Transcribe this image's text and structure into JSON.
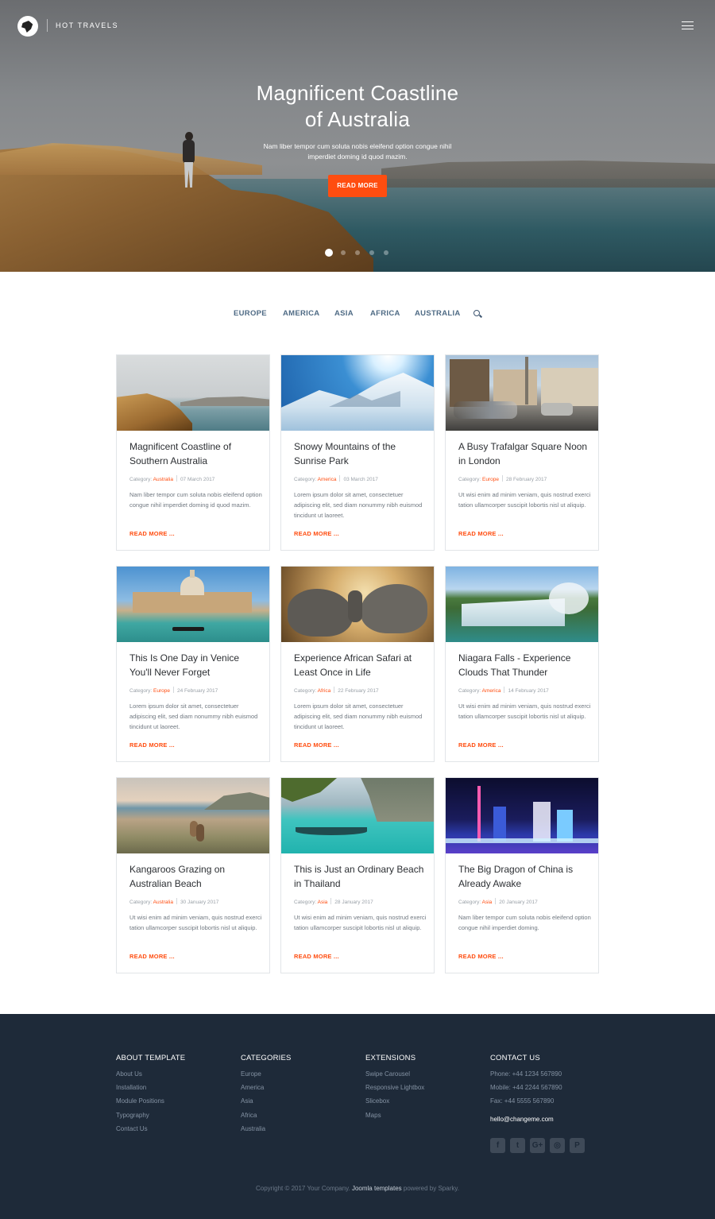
{
  "brand": {
    "name": "HOT TRAVELS",
    "logo": "globe-icon"
  },
  "hero": {
    "title_line1": "Magnificent Coastline",
    "title_line2": "of Australia",
    "subtitle": "Nam liber tempor cum soluta nobis eleifend option congue nihil imperdiet doming id quod mazim.",
    "button": "READ MORE",
    "slide_count": 5,
    "active_slide": 1
  },
  "nav": {
    "items": [
      "EUROPE",
      "AMERICA",
      "ASIA",
      "AFRICA",
      "AUSTRALIA"
    ],
    "search_icon": "search-icon"
  },
  "colors": {
    "accent": "#ff4d10",
    "footer_bg": "#1e2a39",
    "nav_text": "#4f6b85"
  },
  "cards": [
    {
      "title": "Magnificent Coastline of Southern Australia",
      "category_label": "Category:",
      "category": "Australia",
      "date": "07 March 2017",
      "excerpt": "Nam liber tempor cum soluta nobis eleifend option congue nihil imperdiet doming id quod mazim.",
      "more": "READ MORE ..."
    },
    {
      "title": "Snowy Mountains of the Sunrise Park",
      "category_label": "Category:",
      "category": "America",
      "date": "03 March 2017",
      "excerpt": "Lorem ipsum dolor sit amet, consectetuer adipiscing elit, sed diam nonummy nibh euismod tincidunt ut laoreet.",
      "more": "READ MORE ..."
    },
    {
      "title": "A Busy Trafalgar Square Noon in London",
      "category_label": "Category:",
      "category": "Europe",
      "date": "28 February 2017",
      "excerpt": "Ut wisi enim ad minim veniam, quis nostrud exerci tation ullamcorper suscipit lobortis nisl ut aliquip.",
      "more": "READ MORE ..."
    },
    {
      "title": "This Is One Day in Venice You'll Never Forget",
      "category_label": "Category:",
      "category": "Europe",
      "date": "24 February 2017",
      "excerpt": "Lorem ipsum dolor sit amet, consectetuer adipiscing elit, sed diam nonummy nibh euismod tincidunt ut laoreet.",
      "more": "READ MORE ..."
    },
    {
      "title": "Experience African Safari at Least Once in Life",
      "category_label": "Category:",
      "category": "Africa",
      "date": "22 February 2017",
      "excerpt": "Lorem ipsum dolor sit amet, consectetuer adipiscing elit, sed diam nonummy nibh euismod tincidunt ut laoreet.",
      "more": "READ MORE ..."
    },
    {
      "title": "Niagara Falls - Experience Clouds That Thunder",
      "category_label": "Category:",
      "category": "America",
      "date": "14 February 2017",
      "excerpt": "Ut wisi enim ad minim veniam, quis nostrud exerci tation ullamcorper suscipit lobortis nisl ut aliquip.",
      "more": "READ MORE ..."
    },
    {
      "title": "Kangaroos Grazing on Australian Beach",
      "category_label": "Category:",
      "category": "Australia",
      "date": "30 January 2017",
      "excerpt": "Ut wisi enim ad minim veniam, quis nostrud exerci tation ullamcorper suscipit lobortis nisl ut aliquip.",
      "more": "READ MORE ..."
    },
    {
      "title": "This is Just an Ordinary Beach in Thailand",
      "category_label": "Category:",
      "category": "Asia",
      "date": "28 January 2017",
      "excerpt": "Ut wisi enim ad minim veniam, quis nostrud exerci tation ullamcorper suscipit lobortis nisl ut aliquip.",
      "more": "READ MORE ..."
    },
    {
      "title": "The Big Dragon of China is Already Awake",
      "category_label": "Category:",
      "category": "Asia",
      "date": "20 January 2017",
      "excerpt": "Nam liber tempor cum soluta nobis eleifend option congue nihil imperdiet doming.",
      "more": "READ MORE ..."
    }
  ],
  "footer": {
    "about": {
      "heading": "ABOUT TEMPLATE",
      "links": [
        "About Us",
        "Installation",
        "Module Positions",
        "Typography",
        "Contact Us"
      ]
    },
    "categories": {
      "heading": "CATEGORIES",
      "links": [
        "Europe",
        "America",
        "Asia",
        "Africa",
        "Australia"
      ]
    },
    "extensions": {
      "heading": "EXTENSIONS",
      "links": [
        "Swipe Carousel",
        "Responsive Lightbox",
        "Slicebox",
        "Maps"
      ]
    },
    "contact": {
      "heading": "CONTACT US",
      "phone": "Phone: +44 1234 567890",
      "mobile": "Mobile: +44 2244 567890",
      "fax": "Fax: +44 5555 567890",
      "email": "hello@changeme.com",
      "social": [
        {
          "name": "facebook-icon",
          "glyph": "f"
        },
        {
          "name": "twitter-icon",
          "glyph": "t"
        },
        {
          "name": "google-plus-icon",
          "glyph": "G+"
        },
        {
          "name": "instagram-icon",
          "glyph": "◎"
        },
        {
          "name": "pinterest-icon",
          "glyph": "P"
        }
      ]
    },
    "copyright": {
      "before": "Copyright © 2017 Your Company.",
      "link": "Joomla templates",
      "after": "powered by Sparky."
    }
  }
}
